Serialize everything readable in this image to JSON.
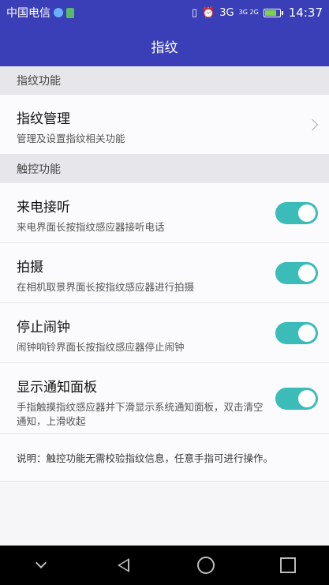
{
  "status_bar": {
    "carrier": "中国电信",
    "network": "3G",
    "network_small": "3G 2G",
    "time": "14:37"
  },
  "title": "指纹",
  "sections": [
    {
      "header": "指纹功能",
      "items": [
        {
          "title": "指纹管理",
          "subtitle": "管理及设置指纹相关功能",
          "control": "chevron"
        }
      ]
    },
    {
      "header": "触控功能",
      "items": [
        {
          "title": "来电接听",
          "subtitle": "来电界面长按指纹感应器接听电话",
          "control": "toggle",
          "on": true
        },
        {
          "title": "拍摄",
          "subtitle": "在相机取景界面长按指纹感应器进行拍摄",
          "control": "toggle",
          "on": true
        },
        {
          "title": "停止闹钟",
          "subtitle": "闹钟响铃界面长按指纹感应器停止闹钟",
          "control": "toggle",
          "on": true
        },
        {
          "title": "显示通知面板",
          "subtitle": "手指触摸指纹感应器并下滑显示系统通知面板，双击清空通知，上滑收起",
          "control": "toggle",
          "on": true
        }
      ]
    }
  ],
  "note": "说明：触控功能无需校验指纹信息，任意手指可进行操作。",
  "colors": {
    "header_bar": "#3a3fb7",
    "toggle_on": "#3bbcb9"
  }
}
